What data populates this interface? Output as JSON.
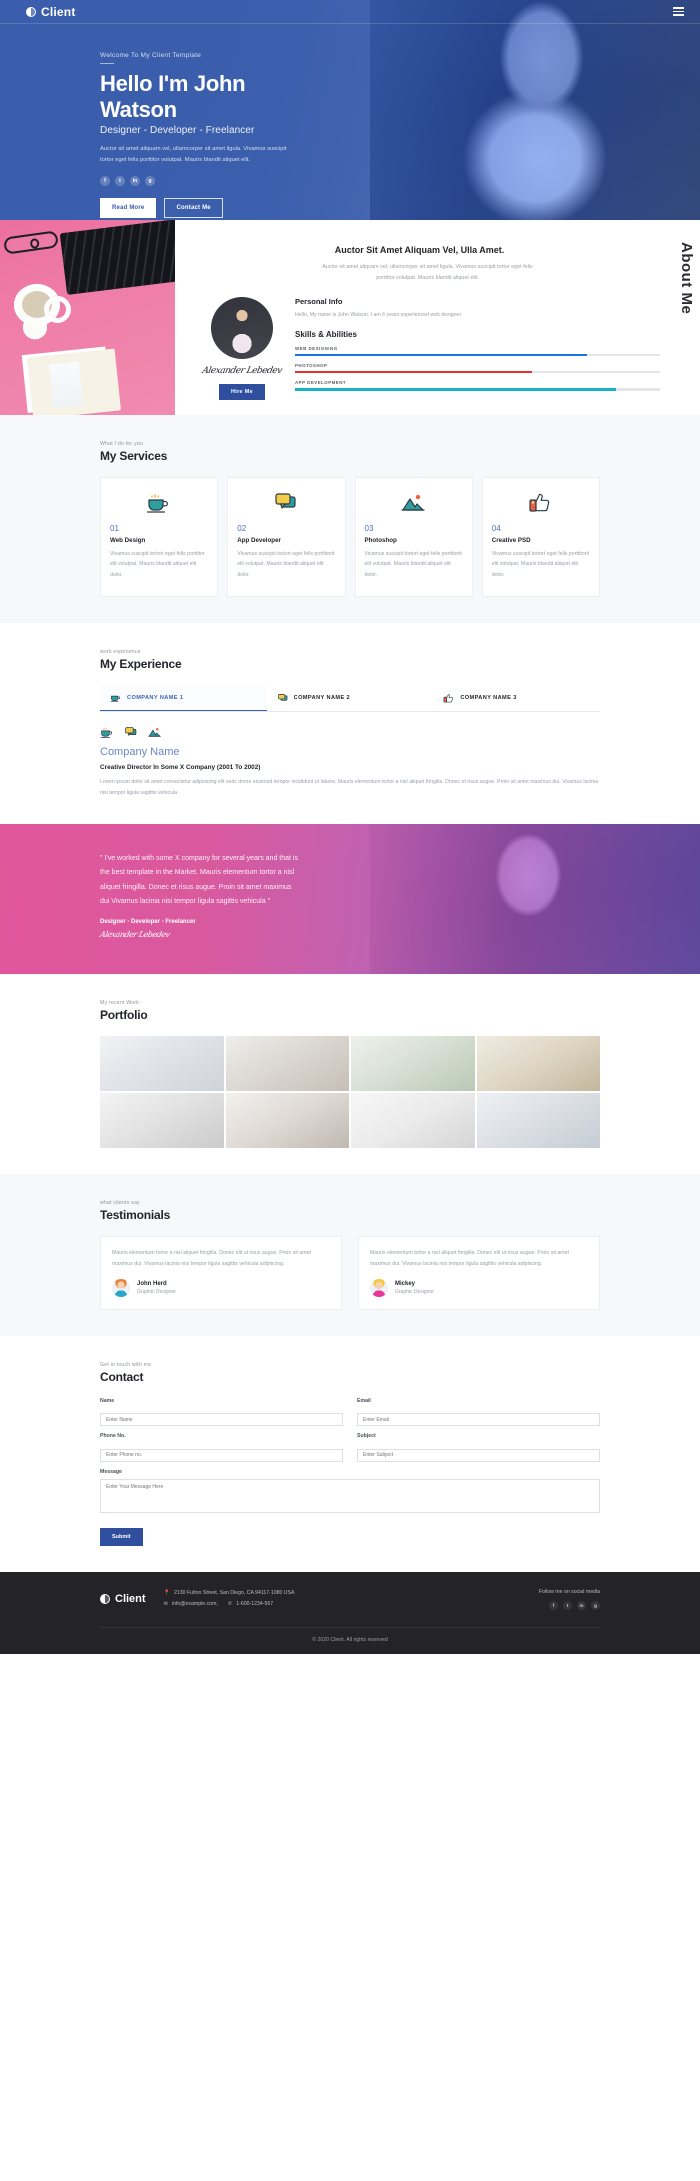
{
  "navbar": {
    "brand": "Client",
    "menu_icon": "hamburger-icon"
  },
  "hero": {
    "welcome": "Welcome To My Client Template",
    "title": "Hello I'm John Watson",
    "subtitle": "Designer - Developer - Freelancer",
    "description": "Auctor sit amet aliquam vel, ullamcorper sit amet ligula. Vivamus suscipit tortor eget felis porttitor volutpat. Mauris blandit aliquet elit.",
    "social": [
      "f",
      "t",
      "in",
      "g"
    ],
    "primary_button": "Read More",
    "secondary_button": "Contact Me"
  },
  "about": {
    "vertical_title": "About Me",
    "heading": "Auctor Sit Amet Aliquam Vel, Ulla Amet.",
    "paragraph": "Auctor sit amet aliquam vel, ullamcorper sit amet ligula. Vivamus suscipit tortor eget felis porttitor volutpat. Mauris blandit aliquet elit.",
    "signature": "Alexander Lebedev",
    "hire_button": "Hire Me",
    "personal_info_heading": "Personal Info",
    "personal_info_text": "Hello, My name is John Watson. I am 6 years experienced web designer",
    "skills_heading": "Skills & Abilities",
    "skills": [
      {
        "label": "WEB DESIGNING",
        "percent": 80,
        "color": "#1a73e8"
      },
      {
        "label": "PHOTOSHOP",
        "percent": 65,
        "color": "#e8302f"
      },
      {
        "label": "APP DEVELOPMENT",
        "percent": 88,
        "color": "#17b2c4"
      }
    ]
  },
  "services": {
    "eyebrow": "What I do for you",
    "title": "My Services",
    "cards": [
      {
        "num": "01",
        "name": "Web Design",
        "text": "Vivamus suscipit tortort eget felis porttitor elit volutpat. Mauris blandit aliquet elit dolor.",
        "icon": "coffee-cup-icon"
      },
      {
        "num": "02",
        "name": "App Developer",
        "text": "Vivamus suscipit tortort eget felis porttitorit elit volutpat. Mauris blandit aliquet elit dolor.",
        "icon": "chat-bubbles-icon"
      },
      {
        "num": "03",
        "name": "Photoshop",
        "text": "Vivamus suscipit tortort eget felis porttitorit elit volutpat. Mauris blandit aliquet elit dolor.",
        "icon": "mountain-image-icon"
      },
      {
        "num": "04",
        "name": "Creative PSD",
        "text": "Vivamus suscipit tortort eget felis porttitorit elit volutpat. Mauris blandit aliquet elit dolor.",
        "icon": "thumbs-up-icon"
      }
    ]
  },
  "experience": {
    "eyebrow": "work experience",
    "title": "My Experience",
    "tabs": [
      {
        "label": "COMPANY NAME 1",
        "icon": "coffee-cup-icon",
        "active": true
      },
      {
        "label": "COMPANY NAME 2",
        "icon": "chat-bubbles-icon",
        "active": false
      },
      {
        "label": "COMPANY NAME 3",
        "icon": "thumbs-up-icon",
        "active": false
      }
    ],
    "company": "Company Name",
    "role": "Creative Director In Some X Company (2001 To 2002)",
    "text": "Lorem ipsum dolor sit amet consectetur adipisicing elit sedc dnmo eiusmod tempor incididunt ut labore. Mauris elementum tortor a nisl aliquet fringilla. Donec et risus augue. Proin sit amet maximus dui. Vivamus lacinia nisi tempor ligula sagittis vehicula."
  },
  "quote": {
    "text": "\" I've worked with some X company for several years and that is the best template in the Market. Mauris elementum tortor a nisl aliquet fringilla. Donec et risus augue. Proin sit amet maximus dui Vivamus lacinia nisi tempor ligula sagittis vehicula \"",
    "name": "Designer - Developer - Freelancer",
    "signature": "Alexander Lebedev"
  },
  "portfolio": {
    "eyebrow": "My recent Work",
    "title": "Portfolio",
    "items": [
      "glasses-and-keyboard",
      "coffee-and-notebook",
      "laptop-with-plant",
      "desk-flatlay",
      "hand-with-phone",
      "hands-typing-laptop",
      "coffee-and-papers",
      "laptop-workspace"
    ]
  },
  "testimonials": {
    "eyebrow": "what clients say",
    "title": "Testimonials",
    "cards": [
      {
        "text": "Mauris elementum tortor a nisl aliquet fringilla. Donec elit ut risus augue. Proin sit amet maximus dui. Vivamus lacinia nisi tempor ligula sagittis vehicula adipiscing.",
        "name": "John Herd",
        "role": "Graphic Designer"
      },
      {
        "text": "Mauris elementum tortor a nisl aliquet fringilla. Donec elit ut risus augue. Proin sit amet maximus dui. Vivamus lacinia nisi tempor ligula sagittis vehicula adipiscing.",
        "name": "Mickey",
        "role": "Graphic Designer"
      }
    ]
  },
  "contact": {
    "eyebrow": "Get in touch with me",
    "title": "Contact",
    "fields": {
      "name_label": "Name",
      "name_placeholder": "Enter Name",
      "email_label": "Email",
      "email_placeholder": "Enter Email",
      "phone_label": "Phone No.",
      "phone_placeholder": "Enter Phone no.",
      "subject_label": "Subject",
      "subject_placeholder": "Enter Subject",
      "message_label": "Message",
      "message_placeholder": "Enter Your Message Here"
    },
    "submit_label": "Submit"
  },
  "footer": {
    "brand": "Client",
    "address": "2130 Fulton Street, San Diego, CA 94117-1080 USA",
    "email": "info@example.com,",
    "phone": "1-600-1234-567",
    "follow_text": "Follow me on social media",
    "social": [
      "f",
      "t",
      "in",
      "g"
    ],
    "copyright": "© 2020 Client. All rights reserved"
  }
}
